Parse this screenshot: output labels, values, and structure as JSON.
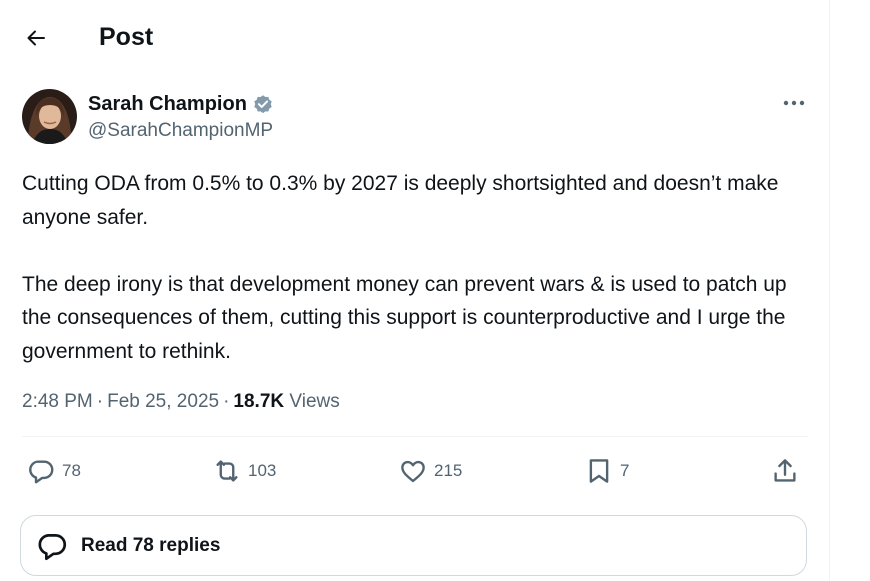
{
  "header": {
    "back_icon": "arrow-left-icon",
    "title": "Post"
  },
  "author": {
    "name": "Sarah Champion",
    "handle": "@SarahChampionMP",
    "verified_color": "#829aab",
    "avatar": "avatar-photo"
  },
  "tweet": {
    "paragraphs": [
      "Cutting ODA from 0.5% to 0.3% by 2027 is deeply shortsighted and doesn’t make anyone safer.",
      "The deep irony is that development money can prevent wars & is used to patch up the consequences of them, cutting this support is counterproductive and I urge the government to rethink."
    ],
    "time": "2:48 PM",
    "date": "Feb 25, 2025",
    "views_count": "18.7K",
    "views_label": "Views"
  },
  "actions": {
    "reply_count": "78",
    "retweet_count": "103",
    "like_count": "215",
    "bookmark_count": "7"
  },
  "replies_button": {
    "label": "Read 78 replies"
  },
  "colors": {
    "text": "#0f1419",
    "muted": "#536471",
    "border": "#cfd9de"
  }
}
